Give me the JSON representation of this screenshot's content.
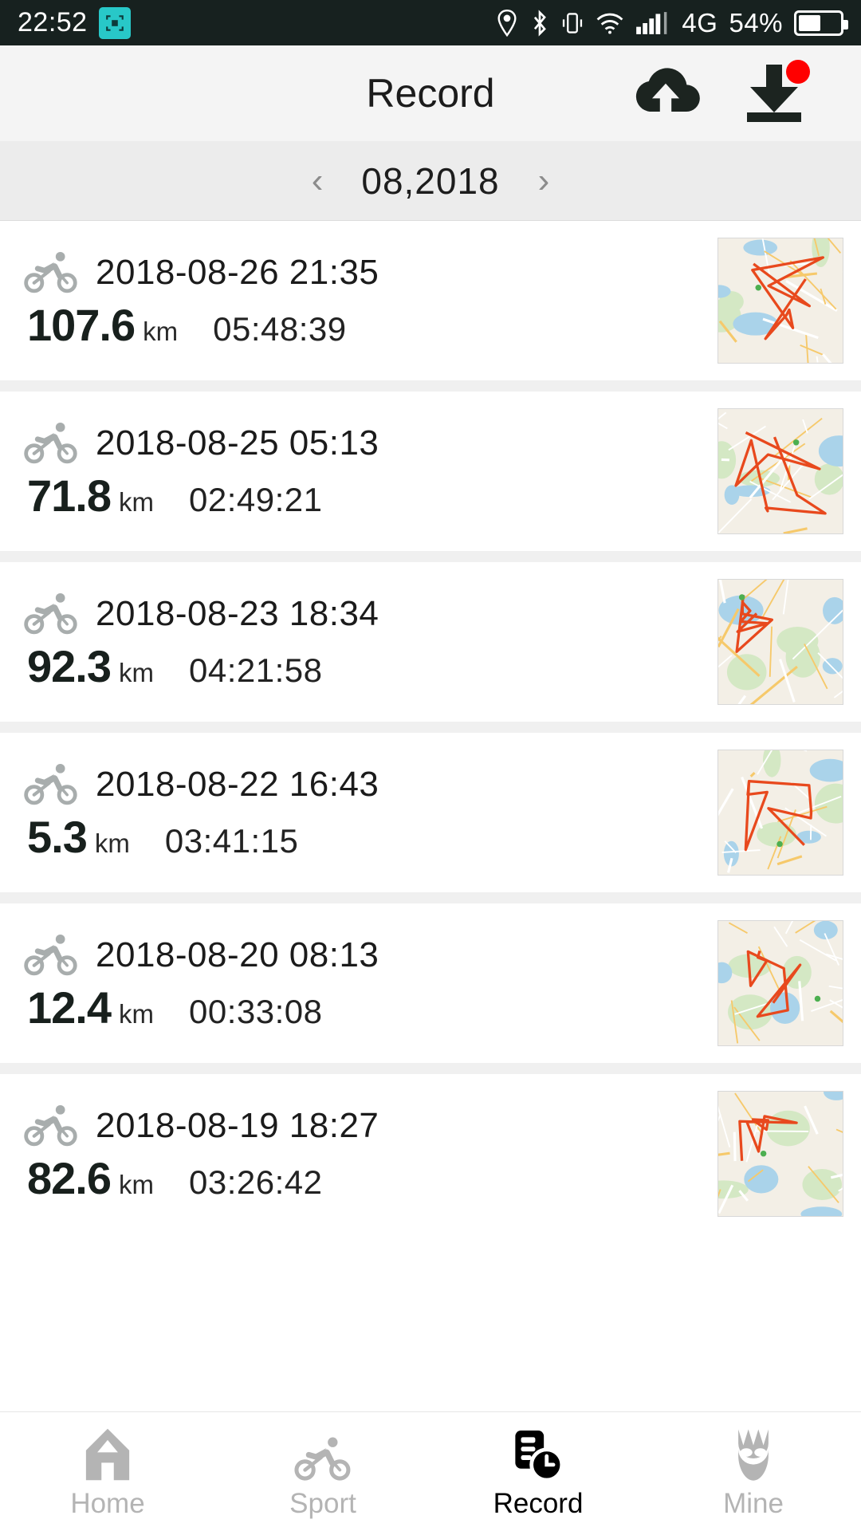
{
  "statusbar": {
    "time": "22:52",
    "badge_icon": "screenshot-icon",
    "icons": [
      "location-icon",
      "bluetooth-icon",
      "vibrate-icon",
      "wifi-icon",
      "signal-icon"
    ],
    "network": "4G",
    "battery_percent": "54%",
    "battery_level": 54,
    "background": "#17211f",
    "badge_color": "#28c8c8"
  },
  "header": {
    "title": "Record",
    "upload_icon": "cloud-upload-icon",
    "download_icon": "download-icon",
    "download_badge": true,
    "badge_color": "#ff0000",
    "background": "#f4f4f4"
  },
  "monthbar": {
    "prev_label": "‹",
    "label": "08,2018",
    "next_label": "›",
    "background": "#ececec"
  },
  "records": [
    {
      "activity_icon": "cycling-icon",
      "datetime": "2018-08-26 21:35",
      "distance": "107.6",
      "unit": "km",
      "duration": "05:48:39",
      "map_thumb": "map-route-thumbnail"
    },
    {
      "activity_icon": "cycling-icon",
      "datetime": "2018-08-25 05:13",
      "distance": "71.8",
      "unit": "km",
      "duration": "02:49:21",
      "map_thumb": "map-route-thumbnail"
    },
    {
      "activity_icon": "cycling-icon",
      "datetime": "2018-08-23 18:34",
      "distance": "92.3",
      "unit": "km",
      "duration": "04:21:58",
      "map_thumb": "map-route-thumbnail"
    },
    {
      "activity_icon": "cycling-icon",
      "datetime": "2018-08-22 16:43",
      "distance": "5.3",
      "unit": "km",
      "duration": "03:41:15",
      "map_thumb": "map-route-thumbnail"
    },
    {
      "activity_icon": "cycling-icon",
      "datetime": "2018-08-20 08:13",
      "distance": "12.4",
      "unit": "km",
      "duration": "00:33:08",
      "map_thumb": "map-route-thumbnail"
    },
    {
      "activity_icon": "cycling-icon",
      "datetime": "2018-08-19 18:27",
      "distance": "82.6",
      "unit": "km",
      "duration": "03:26:42",
      "map_thumb": "map-route-thumbnail"
    }
  ],
  "bottomnav": {
    "items": [
      {
        "label": "Home",
        "icon": "home-icon",
        "active": false
      },
      {
        "label": "Sport",
        "icon": "cycling-icon",
        "active": false
      },
      {
        "label": "Record",
        "icon": "record-clock-icon",
        "active": true
      },
      {
        "label": "Mine",
        "icon": "person-icon",
        "active": false
      }
    ],
    "active_color": "#000000",
    "inactive_color": "#b4b4b4"
  }
}
